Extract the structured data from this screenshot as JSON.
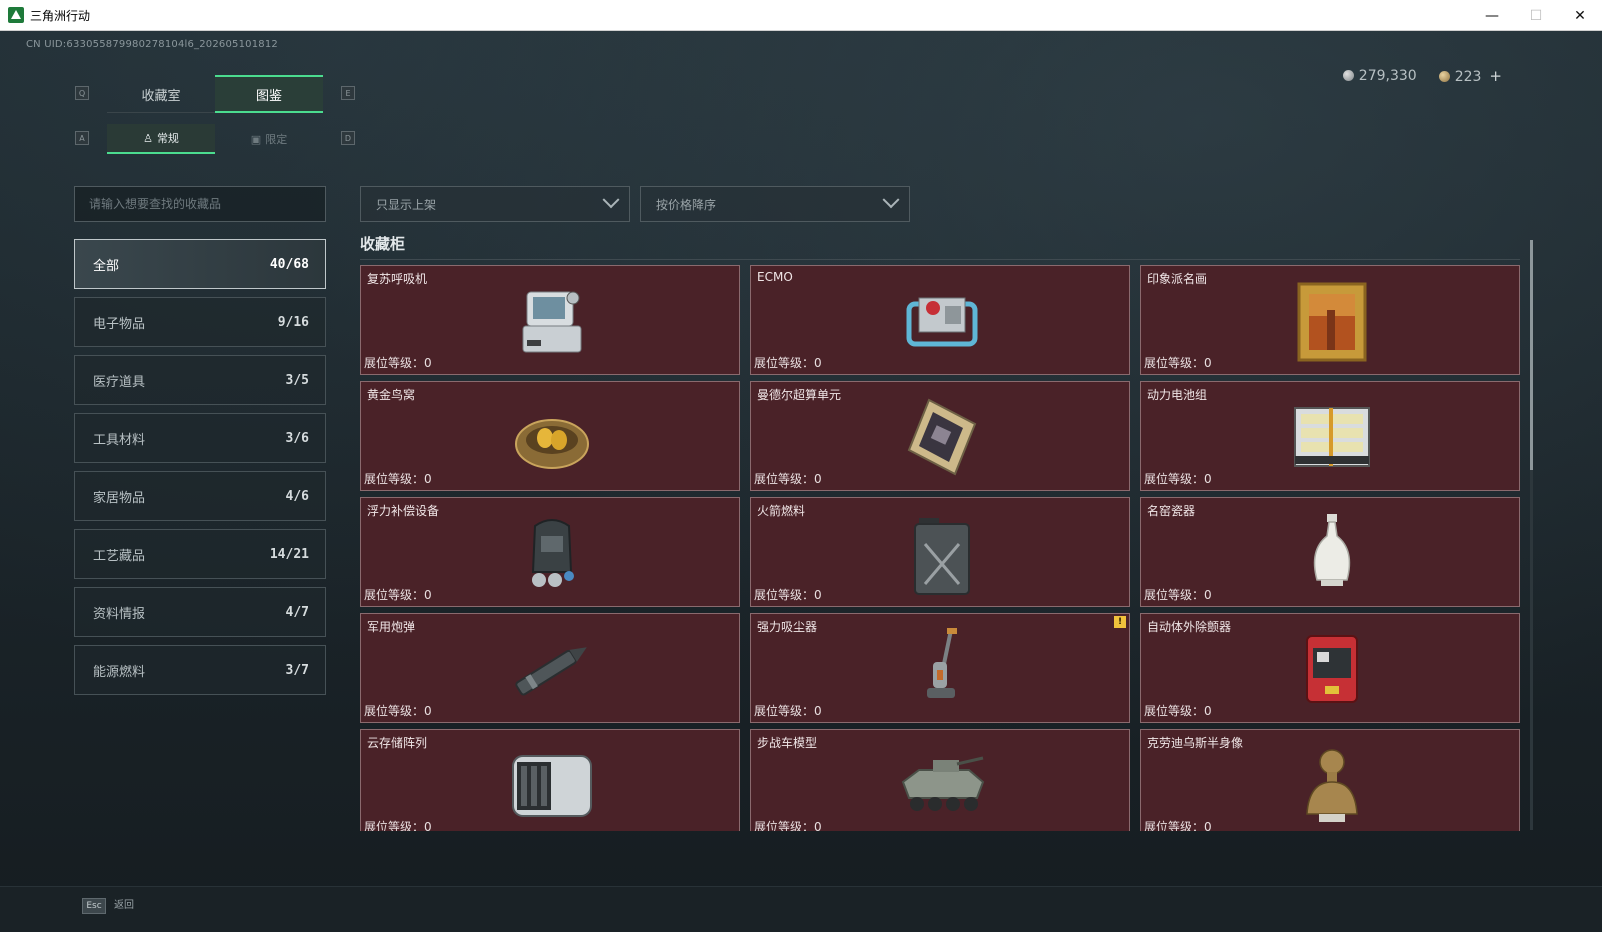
{
  "window": {
    "title": "三角洲行动",
    "minimize": "—",
    "maximize": "☐",
    "close": "✕"
  },
  "header": {
    "uid": "CN UID:633055879980278104l6_202605101812",
    "currency": [
      {
        "icon": "silver-coin-icon",
        "value": "279,330"
      },
      {
        "icon": "gold-coin-icon",
        "value": "223"
      }
    ],
    "add_label": "+"
  },
  "tabs": {
    "left_key": "Q",
    "right_key": "E",
    "items": [
      {
        "label": "收藏室",
        "active": false
      },
      {
        "label": "图鉴",
        "active": true
      }
    ]
  },
  "subtabs": {
    "left_key": "A",
    "right_key": "D",
    "items": [
      {
        "label": "常规",
        "icon": "figure-icon",
        "active": true
      },
      {
        "label": "限定",
        "icon": "image-icon",
        "active": false
      }
    ]
  },
  "search": {
    "placeholder": "请输入想要查找的收藏品"
  },
  "filters": {
    "display": "只显示上架",
    "sort": "按价格降序"
  },
  "categories": [
    {
      "label": "全部",
      "count": "40/68",
      "active": true
    },
    {
      "label": "电子物品",
      "count": "9/16"
    },
    {
      "label": "医疗道具",
      "count": "3/5"
    },
    {
      "label": "工具材料",
      "count": "3/6"
    },
    {
      "label": "家居物品",
      "count": "4/6"
    },
    {
      "label": "工艺藏品",
      "count": "14/21"
    },
    {
      "label": "资料情报",
      "count": "4/7"
    },
    {
      "label": "能源燃料",
      "count": "3/7"
    }
  ],
  "collection": {
    "title": "收藏柜",
    "level_label": "展位等级：",
    "items": [
      {
        "name": "复苏呼吸机",
        "level": "0",
        "icon": "ventilator-icon"
      },
      {
        "name": "ECMO",
        "level": "0",
        "icon": "ecmo-icon"
      },
      {
        "name": "印象派名画",
        "level": "0",
        "icon": "painting-icon"
      },
      {
        "name": "黄金鸟窝",
        "level": "0",
        "icon": "golden-nest-icon"
      },
      {
        "name": "曼德尔超算单元",
        "level": "0",
        "icon": "supercomputer-unit-icon"
      },
      {
        "name": "动力电池组",
        "level": "0",
        "icon": "battery-pack-icon"
      },
      {
        "name": "浮力补偿设备",
        "level": "0",
        "icon": "buoyancy-device-icon"
      },
      {
        "name": "火箭燃料",
        "level": "0",
        "icon": "fuel-can-icon"
      },
      {
        "name": "名窑瓷器",
        "level": "0",
        "icon": "porcelain-vase-icon"
      },
      {
        "name": "军用炮弹",
        "level": "0",
        "icon": "artillery-shell-icon"
      },
      {
        "name": "强力吸尘器",
        "level": "0",
        "icon": "vacuum-cleaner-icon",
        "badge": "!"
      },
      {
        "name": "自动体外除颤器",
        "level": "0",
        "icon": "defibrillator-icon"
      },
      {
        "name": "云存储阵列",
        "level": "0",
        "icon": "storage-array-icon"
      },
      {
        "name": "步战车模型",
        "level": "0",
        "icon": "ifv-model-icon"
      },
      {
        "name": "克劳迪乌斯半身像",
        "level": "0",
        "icon": "bust-icon"
      }
    ]
  },
  "footer": {
    "esc_key": "Esc",
    "back_label": "返回"
  },
  "colors": {
    "accent": "#4bdc8f",
    "card_bg": "#4a2228",
    "card_border": "#8a6a6e",
    "badge": "#f0c23c"
  }
}
